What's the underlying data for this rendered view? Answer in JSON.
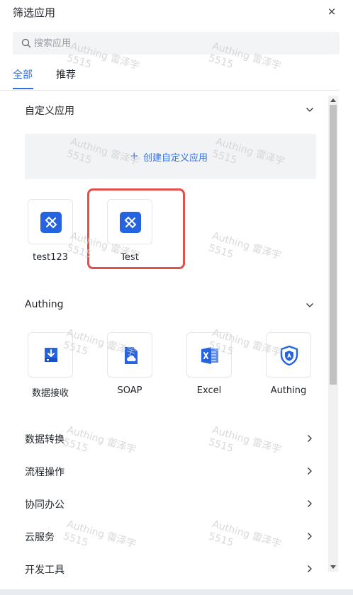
{
  "header": {
    "title": "筛选应用",
    "close_icon": "close-icon",
    "close_glyph": "×"
  },
  "search": {
    "placeholder": "搜索应用",
    "value": "",
    "icon": "search-icon"
  },
  "tabs": [
    {
      "label": "全部",
      "active": true
    },
    {
      "label": "推荐",
      "active": false
    }
  ],
  "sections": {
    "custom": {
      "label": "自定义应用",
      "expanded": true,
      "create_label": "创建自定义应用",
      "create_icon": "plus-icon",
      "create_glyph": "+",
      "apps": [
        {
          "name": "test123",
          "icon": "custom-app-icon"
        },
        {
          "name": "Test",
          "icon": "custom-app-icon",
          "highlighted": true
        }
      ]
    },
    "authing": {
      "label": "Authing",
      "expanded": true,
      "apps": [
        {
          "name": "数据接收",
          "icon": "data-receive-icon"
        },
        {
          "name": "SOAP",
          "icon": "soap-icon"
        },
        {
          "name": "Excel",
          "icon": "excel-icon"
        },
        {
          "name": "Authing",
          "icon": "authing-shield-icon"
        }
      ]
    }
  },
  "categories": [
    {
      "label": "数据转换",
      "expanded": false
    },
    {
      "label": "流程操作",
      "expanded": false
    },
    {
      "label": "协同办公",
      "expanded": false
    },
    {
      "label": "云服务",
      "expanded": false
    },
    {
      "label": "开发工具",
      "expanded": false
    }
  ],
  "watermark": {
    "text": "Authing 雷泽宇",
    "code": "5515"
  },
  "colors": {
    "accent": "#2f6fea",
    "highlight": "#e0504d",
    "tile_blue": "#2563e0"
  }
}
